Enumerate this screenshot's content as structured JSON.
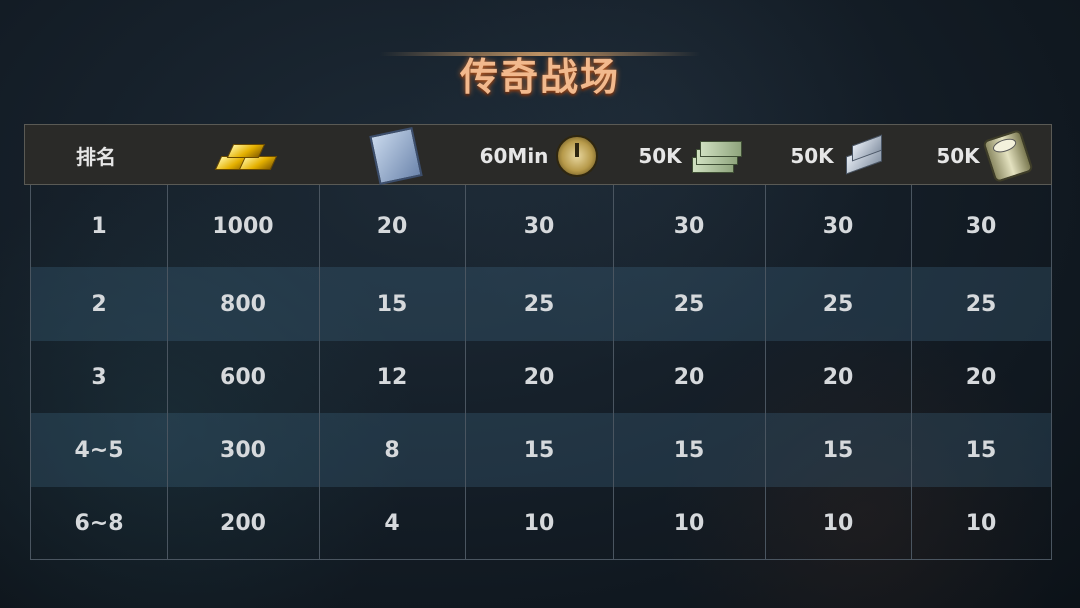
{
  "title": "传奇战场",
  "header": {
    "rank": "排名",
    "columns": [
      {
        "label": "",
        "icon": "gold-bars-icon"
      },
      {
        "label": "",
        "icon": "exp-book-icon"
      },
      {
        "label": "60Min",
        "icon": "speedup-clock-icon"
      },
      {
        "label": "50K",
        "icon": "cash-stack-icon"
      },
      {
        "label": "50K",
        "icon": "steel-plate-icon"
      },
      {
        "label": "50K",
        "icon": "oil-barrel-icon"
      }
    ]
  },
  "rows": [
    {
      "rank": "1",
      "values": [
        "1000",
        "20",
        "30",
        "30",
        "30",
        "30"
      ]
    },
    {
      "rank": "2",
      "values": [
        "800",
        "15",
        "25",
        "25",
        "25",
        "25"
      ]
    },
    {
      "rank": "3",
      "values": [
        "600",
        "12",
        "20",
        "20",
        "20",
        "20"
      ]
    },
    {
      "rank": "4~5",
      "values": [
        "300",
        "8",
        "15",
        "15",
        "15",
        "15"
      ]
    },
    {
      "rank": "6~8",
      "values": [
        "200",
        "4",
        "10",
        "10",
        "10",
        "10"
      ]
    }
  ]
}
